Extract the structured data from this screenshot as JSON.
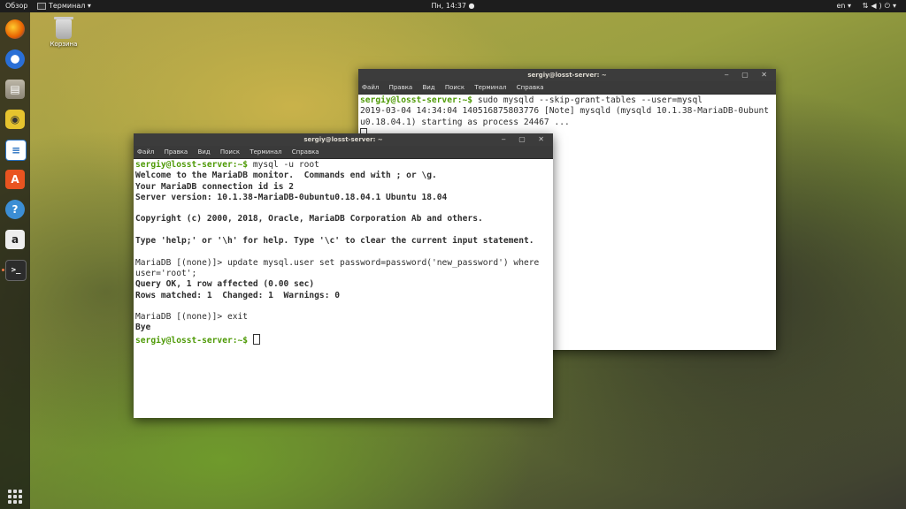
{
  "topbar": {
    "activities": "Обзор",
    "app_menu": "Терминал ▾",
    "clock": "Пн, 14:37 ●",
    "keyboard": "en ▾",
    "system": "▾"
  },
  "desktop": {
    "trash_label": "Корзина"
  },
  "dock": {
    "items": [
      {
        "name": "firefox",
        "color": "#e66000"
      },
      {
        "name": "thunderbird",
        "color": "#2a6fd6"
      },
      {
        "name": "files",
        "color": "#9a9486"
      },
      {
        "name": "rhythmbox",
        "color": "#e6c42e"
      },
      {
        "name": "libreoffice-writer",
        "color": "#2a72c2"
      },
      {
        "name": "software-center",
        "color": "#e95420"
      },
      {
        "name": "help",
        "color": "#3c8ed4"
      },
      {
        "name": "amazon",
        "color": "#dddddd"
      },
      {
        "name": "terminal",
        "color": "#2c2c2c"
      }
    ]
  },
  "windows": {
    "back": {
      "title": "sergiy@losst-server: ~",
      "controls": "‒ ▢ ✕",
      "menu": [
        "Файл",
        "Правка",
        "Вид",
        "Поиск",
        "Терминал",
        "Справка"
      ],
      "prompt": "sergiy@losst-server:~$",
      "command": " sudo mysqld --skip-grant-tables --user=mysql",
      "lines": [
        "2019-03-04 14:34:04 140516875803776 [Note] mysqld (mysqld 10.1.38-MariaDB-0ubunt",
        "u0.18.04.1) starting as process 24467 ..."
      ]
    },
    "front": {
      "title": "sergiy@losst-server: ~",
      "controls": "‒ ▢ ✕",
      "menu": [
        "Файл",
        "Правка",
        "Вид",
        "Поиск",
        "Терминал",
        "Справка"
      ],
      "prompt": "sergiy@losst-server:~$",
      "command1": " mysql -u root",
      "welcome": [
        "Welcome to the MariaDB monitor.  Commands end with ; or \\g.",
        "Your MariaDB connection id is 2",
        "Server version: 10.1.38-MariaDB-0ubuntu0.18.04.1 Ubuntu 18.04"
      ],
      "copyright": "Copyright (c) 2000, 2018, Oracle, MariaDB Corporation Ab and others.",
      "help_line": "Type 'help;' or '\\h' for help. Type '\\c' to clear the current input statement.",
      "update_cmd_1": "MariaDB [(none)]> update mysql.user set password=password('new_password') where",
      "update_cmd_2": "user='root';",
      "query_ok": "Query OK, 1 row affected (0.00 sec)",
      "rows_matched": "Rows matched: 1  Changed: 1  Warnings: 0",
      "exit_cmd": "MariaDB [(none)]> exit",
      "bye": "Bye",
      "prompt2": "sergiy@losst-server:~$"
    }
  }
}
